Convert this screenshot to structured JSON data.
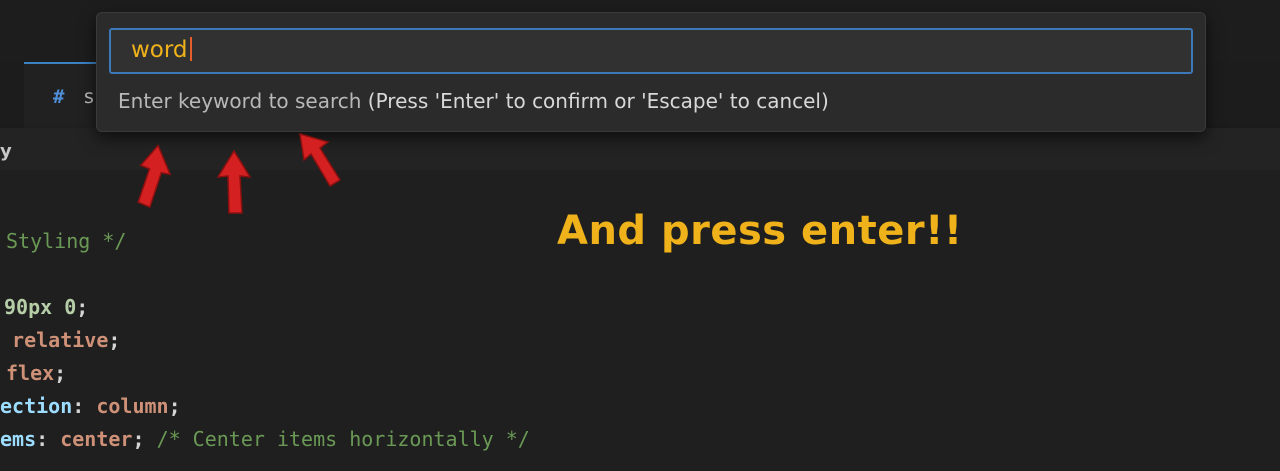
{
  "editor_tab": {
    "hash_icon": "#",
    "label": "s"
  },
  "breadcrumb": {
    "text": "y"
  },
  "quick_input": {
    "value": "word",
    "hint_main": "Enter keyword to search",
    "hint_extra": " (Press 'Enter' to confirm or 'Escape' to cancel)"
  },
  "annotation": {
    "text": "And press enter!!",
    "color": "#f0b21a"
  },
  "code_lines": [
    [
      {
        "t": "Styling */",
        "c": "comment"
      }
    ],
    [],
    [
      {
        "t": "90px 0",
        "c": "number"
      },
      {
        "t": ";",
        "c": "punc"
      }
    ],
    [
      {
        "t": " relative",
        "c": "value"
      },
      {
        "t": ";",
        "c": "punc"
      }
    ],
    [
      {
        "t": "flex",
        "c": "value"
      },
      {
        "t": ";",
        "c": "punc"
      }
    ],
    [
      {
        "t": "ection",
        "c": "prop"
      },
      {
        "t": ": ",
        "c": "punc"
      },
      {
        "t": "column",
        "c": "value"
      },
      {
        "t": ";",
        "c": "punc"
      }
    ],
    [
      {
        "t": "ems",
        "c": "prop"
      },
      {
        "t": ": ",
        "c": "punc"
      },
      {
        "t": "center",
        "c": "value"
      },
      {
        "t": "; ",
        "c": "punc"
      },
      {
        "t": "/* Center items horizontally */",
        "c": "comment"
      }
    ]
  ],
  "colors": {
    "accent_border": "#3d79b8",
    "arrow_red": "#d42020"
  },
  "icons": {
    "pointer_arrows": "red-arrow-icon"
  }
}
